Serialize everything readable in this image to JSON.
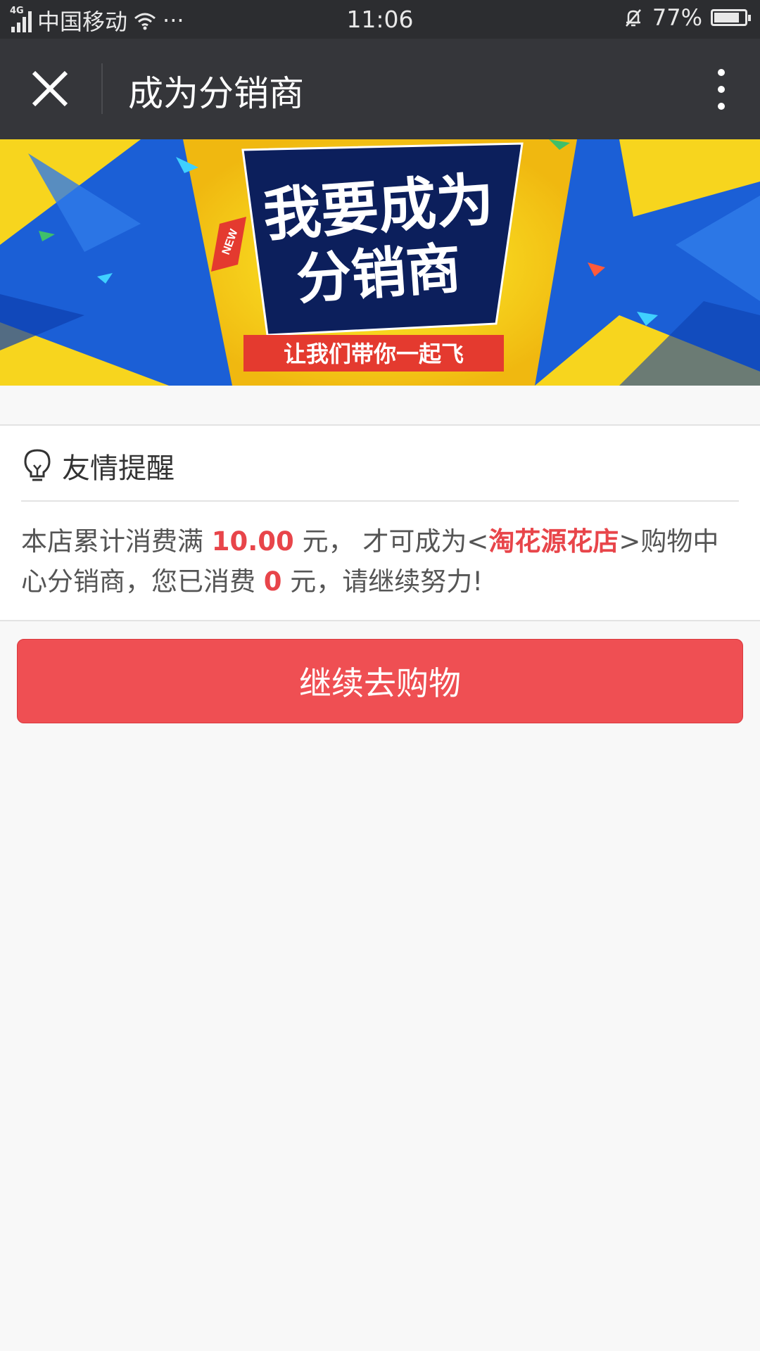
{
  "status_bar": {
    "network": "4G",
    "carrier": "中国移动",
    "more": "···",
    "time": "11:06",
    "battery": "77%"
  },
  "navbar": {
    "title": "成为分销商",
    "close_icon": "close-icon",
    "more_icon": "more-vertical-icon"
  },
  "banner": {
    "headline_line1": "我要成为",
    "headline_line2": "分销商",
    "badge": "NEW",
    "ribbon": "让我们带你一起飞",
    "colors": {
      "blue": "#1b5fd6",
      "yellow": "#f7d51e",
      "navy": "#0c1f5c",
      "red": "#e43a2f"
    }
  },
  "notice": {
    "icon": "lightbulb-icon",
    "title": "友情提醒",
    "text_1": "本店累计消费满 ",
    "threshold": "10.00",
    "text_2": " 元， 才可成为<",
    "shop_name": "淘花源花店",
    "text_3": ">购物中心分销商，您已消费 ",
    "spent": "0",
    "text_4": " 元，请继续努力!"
  },
  "actions": {
    "continue_shopping": "继续去购物"
  },
  "colors": {
    "accent": "#ef4f53",
    "highlight": "#e8454a",
    "navbar": "#35363a",
    "statusbar": "#2c2d30"
  }
}
